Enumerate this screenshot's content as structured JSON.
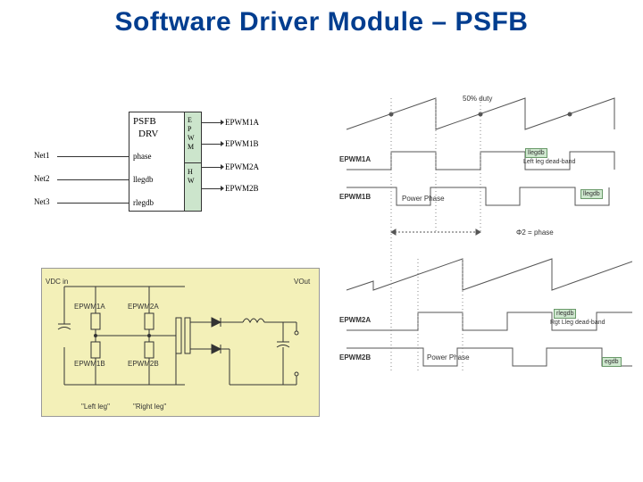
{
  "title": "Software Driver Module – PSFB",
  "block": {
    "name": "PSFB",
    "name2": "DRV",
    "ports": [
      "phase",
      "llegdb",
      "rlegdb"
    ],
    "nets": [
      "Net1",
      "Net2",
      "Net3"
    ],
    "epwm_short": [
      "E",
      "P",
      "W",
      "M"
    ],
    "hw_short": [
      "H",
      "W"
    ],
    "outputs": [
      "EPWM1A",
      "EPWM1B",
      "EPWM2A",
      "EPWM2B"
    ]
  },
  "circuit": {
    "vin": "VDC in",
    "vout": "VOut",
    "q": [
      "EPWM1A",
      "EPWM2A",
      "EPWM1B",
      "EPWM2B"
    ],
    "leftleg": "\"Left leg\"",
    "rightleg": "\"Right leg\""
  },
  "timing": {
    "duty": "50% duty",
    "rows": [
      "EPWM1A",
      "EPWM1B",
      "EPWM2A",
      "EPWM2B"
    ],
    "phi2": "Φ2 = phase",
    "power_phase": "Power Phase",
    "llegdb": "llegdb",
    "llegdb_desc": "Left leg dead-band",
    "rlegdb": "rlegdb",
    "rlegdb_desc": "Rgt Lleg dead-band",
    "llegdb2": "llegdb",
    "egdb": "egdb"
  }
}
